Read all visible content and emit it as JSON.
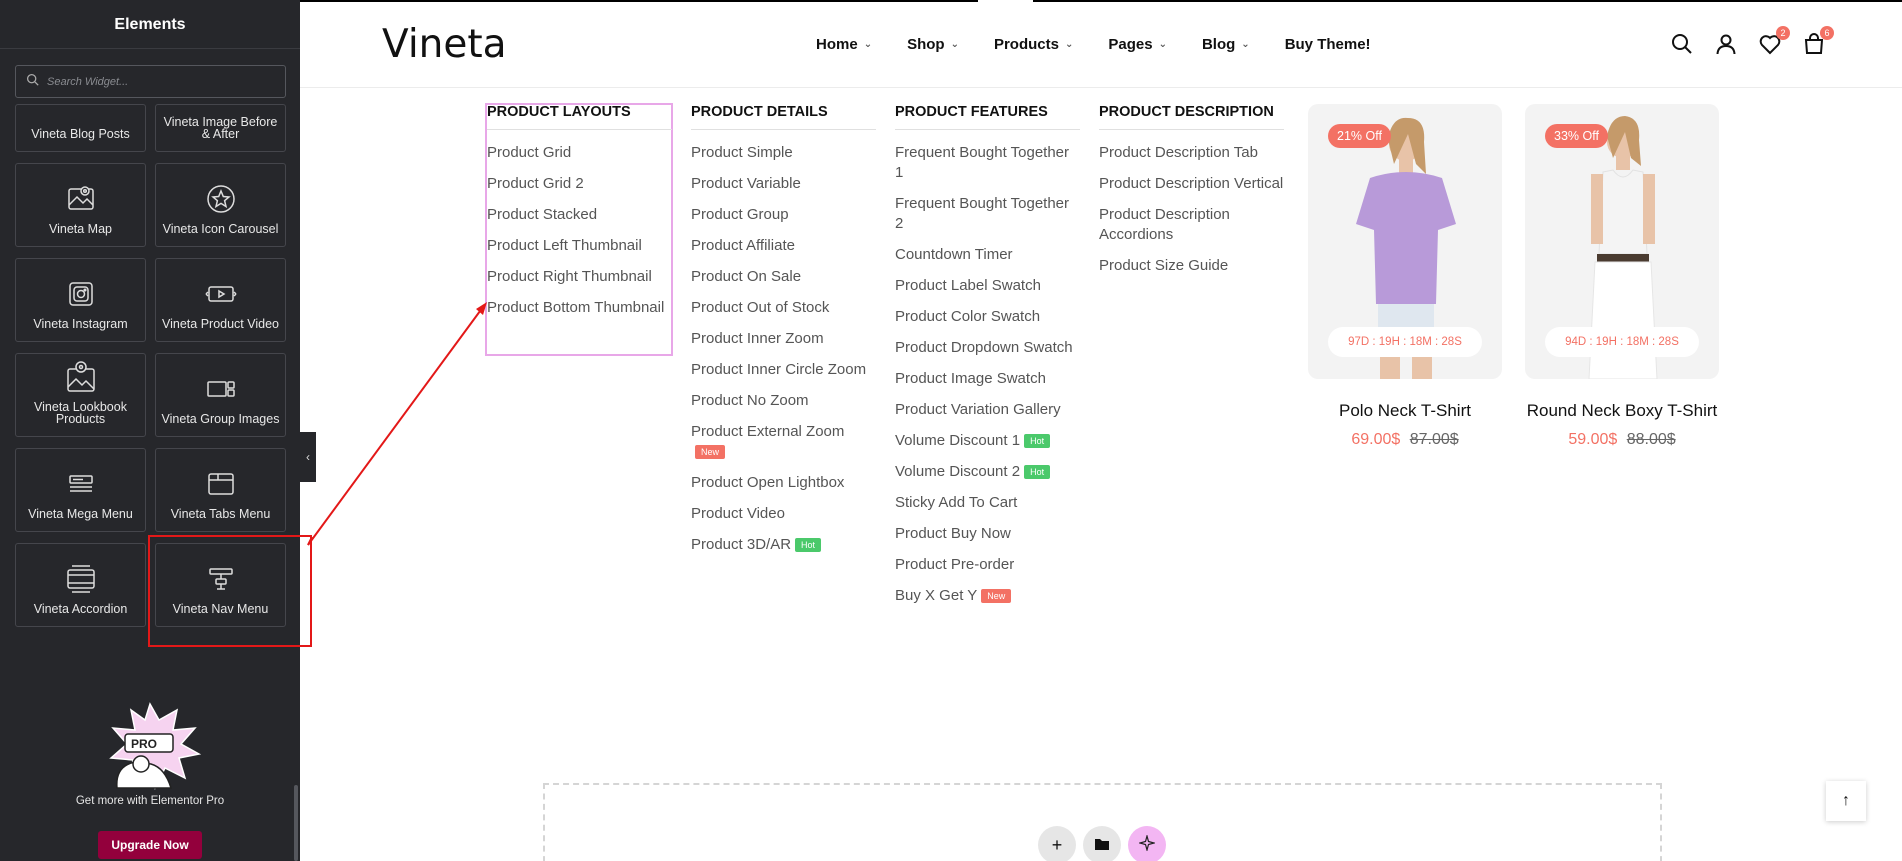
{
  "sidebar": {
    "title": "Elements",
    "search_placeholder": "Search Widget...",
    "widgets": [
      {
        "label": "Vineta Blog Posts",
        "icon": "blog-posts-icon"
      },
      {
        "label": "Vineta Image Before & After",
        "icon": "image-compare-icon"
      },
      {
        "label": "Vineta Map",
        "icon": "map-icon"
      },
      {
        "label": "Vineta Icon Carousel",
        "icon": "star-circle-icon"
      },
      {
        "label": "Vineta Instagram",
        "icon": "instagram-icon"
      },
      {
        "label": "Vineta Product Video",
        "icon": "video-icon"
      },
      {
        "label": "Vineta Lookbook Products",
        "icon": "lookbook-icon"
      },
      {
        "label": "Vineta Group Images",
        "icon": "group-images-icon"
      },
      {
        "label": "Vineta Mega Menu",
        "icon": "mega-menu-icon"
      },
      {
        "label": "Vineta Tabs Menu",
        "icon": "tabs-icon"
      },
      {
        "label": "Vineta Accordion",
        "icon": "accordion-icon"
      },
      {
        "label": "Vineta Nav Menu",
        "icon": "nav-menu-icon"
      }
    ],
    "promo": {
      "text": "Get more with Elementor Pro",
      "button": "Upgrade Now"
    }
  },
  "header": {
    "logo": "Vineta",
    "nav": [
      "Home",
      "Shop",
      "Products",
      "Pages",
      "Blog",
      "Buy Theme!"
    ],
    "wishlist_count": "2",
    "cart_count": "6"
  },
  "mega_menu": {
    "columns": [
      {
        "heading": "PRODUCT LAYOUTS",
        "links": [
          {
            "label": "Product Grid"
          },
          {
            "label": "Product Grid 2"
          },
          {
            "label": "Product Stacked"
          },
          {
            "label": "Product Left Thumbnail"
          },
          {
            "label": "Product Right Thumbnail"
          },
          {
            "label": "Product Bottom Thumbnail"
          }
        ]
      },
      {
        "heading": "PRODUCT DETAILS",
        "links": [
          {
            "label": "Product Simple"
          },
          {
            "label": "Product Variable"
          },
          {
            "label": "Product Group"
          },
          {
            "label": "Product Affiliate"
          },
          {
            "label": "Product On Sale"
          },
          {
            "label": "Product Out of Stock"
          },
          {
            "label": "Product Inner Zoom"
          },
          {
            "label": "Product Inner Circle Zoom"
          },
          {
            "label": "Product No Zoom"
          },
          {
            "label": "Product External Zoom",
            "badge": "New"
          },
          {
            "label": "Product Open Lightbox"
          },
          {
            "label": "Product Video"
          },
          {
            "label": "Product 3D/AR",
            "badge": "Hot"
          }
        ]
      },
      {
        "heading": "PRODUCT FEATURES",
        "links": [
          {
            "label": "Frequent Bought Together 1"
          },
          {
            "label": "Frequent Bought Together 2"
          },
          {
            "label": "Countdown Timer"
          },
          {
            "label": "Product Label Swatch"
          },
          {
            "label": "Product Color Swatch"
          },
          {
            "label": "Product Dropdown Swatch"
          },
          {
            "label": "Product Image Swatch"
          },
          {
            "label": "Product Variation Gallery"
          },
          {
            "label": "Volume Discount 1",
            "badge": "Hot"
          },
          {
            "label": "Volume Discount 2",
            "badge": "Hot"
          },
          {
            "label": "Sticky Add To Cart"
          },
          {
            "label": "Product Buy Now"
          },
          {
            "label": "Product Pre-order"
          },
          {
            "label": "Buy X Get Y",
            "badge": "New"
          }
        ]
      },
      {
        "heading": "PRODUCT DESCRIPTION",
        "links": [
          {
            "label": "Product Description Tab"
          },
          {
            "label": "Product Description Vertical"
          },
          {
            "label": "Product Description Accordions"
          },
          {
            "label": "Product Size Guide"
          }
        ]
      }
    ],
    "products": [
      {
        "name": "Polo Neck T-Shirt",
        "discount": "21% Off",
        "timer": "97D : 19H : 18M : 28S",
        "price": "69.00$",
        "old_price": "87.00$",
        "shirt_color": "#b89ad9"
      },
      {
        "name": "Round Neck Boxy T-Shirt",
        "discount": "33% Off",
        "timer": "94D : 19H : 18M : 28S",
        "price": "59.00$",
        "old_price": "88.00$",
        "shirt_color": "#f4f4f4"
      }
    ]
  },
  "colors": {
    "accent": "#f37164",
    "hot": "#4bc96b",
    "sidebar_bg": "#26272b",
    "highlight": "#e31818",
    "upgrade": "#93003c"
  }
}
